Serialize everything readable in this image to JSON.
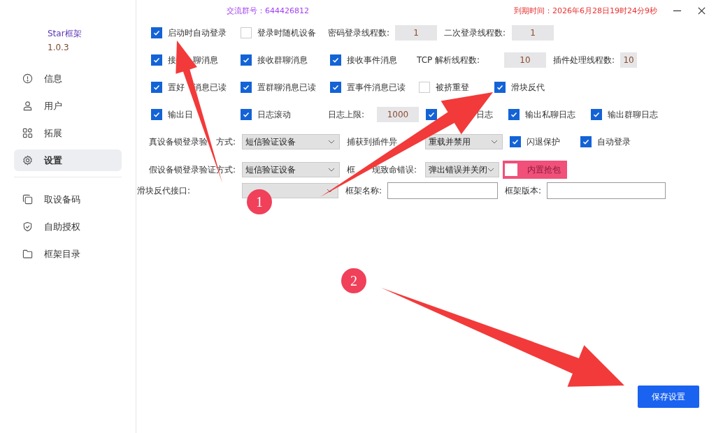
{
  "sidebar": {
    "title": "Star框架",
    "version": "1.0.3",
    "groups": [
      [
        {
          "label": "信息",
          "selected": false
        },
        {
          "label": "用户",
          "selected": false
        },
        {
          "label": "拓展",
          "selected": false
        },
        {
          "label": "设置",
          "selected": true
        }
      ],
      [
        {
          "label": "取设备码",
          "selected": false
        },
        {
          "label": "自助授权",
          "selected": false
        },
        {
          "label": "框架目录",
          "selected": false
        }
      ]
    ]
  },
  "header": {
    "group_number": "交流群号：644426812",
    "expiry": "到期时间：2026年6月28日19时24分9秒"
  },
  "rows": [
    [
      {
        "kind": "checkbox",
        "label": "启动时自动登录",
        "checked": true
      },
      {
        "kind": "checkbox",
        "label": "登录时随机设备",
        "checked": false
      },
      {
        "kind": "number",
        "label": "密码登录线程数:",
        "value": "1"
      },
      {
        "kind": "number",
        "label": "二次登录线程数:",
        "value": "1"
      }
    ],
    [
      {
        "kind": "checkbox",
        "label": [
          "接",
          "聊消息"
        ],
        "checked": true
      },
      {
        "kind": "checkbox",
        "label": "接收群聊消息",
        "checked": true
      },
      {
        "kind": "checkbox",
        "label": "接收事件消息",
        "checked": true
      },
      {
        "kind": "number",
        "label": "TCP 解析线程数:",
        "value": "10"
      },
      {
        "kind": "number",
        "label": "插件处理线程数:",
        "value": "10"
      }
    ],
    [
      {
        "kind": "checkbox",
        "label": [
          "置好",
          "消息已读"
        ],
        "checked": true
      },
      {
        "kind": "checkbox",
        "label": "置群聊消息已读",
        "checked": true
      },
      {
        "kind": "checkbox",
        "label": "置事件消息已读",
        "checked": true
      },
      {
        "kind": "checkbox",
        "label": "被挤重登",
        "checked": false
      },
      {
        "kind": "checkbox",
        "label": "滑块反代",
        "checked": true
      }
    ],
    [
      {
        "kind": "checkbox",
        "label": [
          "输出日"
        ],
        "checked": true
      },
      {
        "kind": "checkbox",
        "label": "日志滚动",
        "checked": true
      },
      {
        "kind": "number",
        "label": "日志上限:",
        "value": "1000"
      },
      {
        "kind": "checkbox",
        "label": [
          "日志"
        ],
        "checked": true
      },
      {
        "kind": "checkbox",
        "label": "输出私聊日志",
        "checked": true
      },
      {
        "kind": "checkbox",
        "label": "输出群聊日志",
        "checked": true
      }
    ],
    [
      {
        "kind": "select",
        "label": [
          "真设备锁登录验",
          "方式:"
        ],
        "value": "短信验证设备"
      },
      {
        "kind": "select",
        "label": [
          "捕获到插件异"
        ],
        "value": "重载并禁用"
      },
      {
        "kind": "checkbox",
        "label": "闪退保护",
        "checked": true
      },
      {
        "kind": "checkbox",
        "label": "自动登录",
        "checked": true
      }
    ],
    [
      {
        "kind": "select",
        "label": "假设备锁登录验证方式:",
        "value": "短信验证设备"
      },
      {
        "kind": "select",
        "label": [
          "框",
          "现致命错误:"
        ],
        "value": "弹出错误并关闭"
      },
      {
        "kind": "pinkbox",
        "label": "内置抢包",
        "checked": false
      }
    ],
    [
      {
        "kind": "select",
        "label": "滑块反代接口:"
      },
      {
        "kind": "text",
        "label": "框架名称:"
      },
      {
        "kind": "text",
        "label": "框架版本:"
      }
    ]
  ],
  "save_button": "保存设置",
  "annotations": {
    "badges": [
      "1",
      "2"
    ]
  }
}
